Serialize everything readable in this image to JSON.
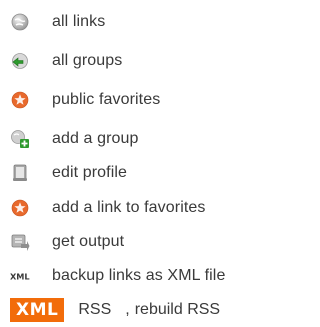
{
  "menu": {
    "items": [
      {
        "label": "all links",
        "icon": "world-icon"
      },
      {
        "label": "all groups",
        "icon": "groups-icon"
      },
      {
        "label": "public favorites",
        "icon": "star-icon"
      },
      {
        "label": "add a group",
        "icon": "add-group-icon"
      },
      {
        "label": "edit profile",
        "icon": "profile-icon"
      },
      {
        "label": "add a link to favorites",
        "icon": "star-icon"
      },
      {
        "label": "get output",
        "icon": "output-icon"
      },
      {
        "label": "backup links as XML file",
        "icon": "xml-file-icon"
      }
    ]
  },
  "feeds": {
    "xml_badge": "XML",
    "rss_label": "RSS",
    "separator": ",",
    "rebuild_label": "rebuild RSS"
  },
  "colors": {
    "text": "#3a3a3a",
    "xml_badge_bg": "#f26c0a",
    "star": "#e8692c"
  }
}
